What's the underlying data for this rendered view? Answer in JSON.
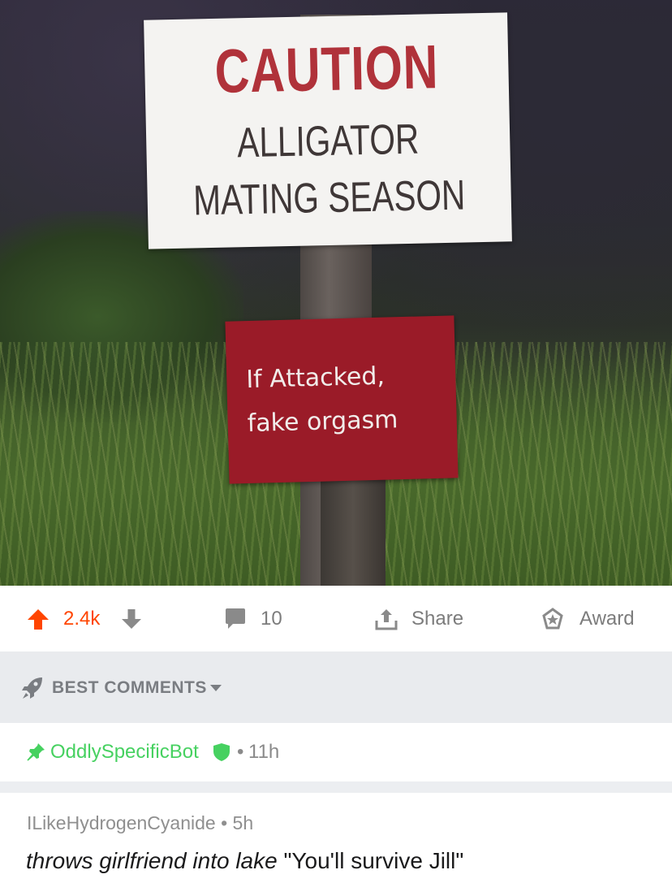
{
  "photo": {
    "sign_top": {
      "line1": "CAUTION",
      "line2": "ALLIGATOR",
      "line3": "MATING SEASON"
    },
    "sign_bottom": {
      "line1": "If Attacked,",
      "line2": "fake orgasm"
    }
  },
  "actions": {
    "score": "2.4k",
    "comments_count": "10",
    "share_label": "Share",
    "award_label": "Award"
  },
  "sort": {
    "label": "BEST COMMENTS"
  },
  "pinned_comment": {
    "author": "OddlySpecificBot",
    "separator": "•",
    "time": "11h"
  },
  "comment": {
    "author": "ILikeHydrogenCyanide",
    "separator": "•",
    "time": "5h",
    "body_italic": "throws girlfriend into lake",
    "body_rest": " \"You'll survive Jill\""
  },
  "colors": {
    "upvote": "#ff4500",
    "mod_green": "#46d160",
    "muted": "#7c7c7c"
  },
  "icons": [
    "upvote-arrow-icon",
    "downvote-arrow-icon",
    "comment-bubble-icon",
    "share-icon",
    "award-icon",
    "rocket-icon",
    "caret-down-icon",
    "pin-icon",
    "mod-shield-icon"
  ]
}
